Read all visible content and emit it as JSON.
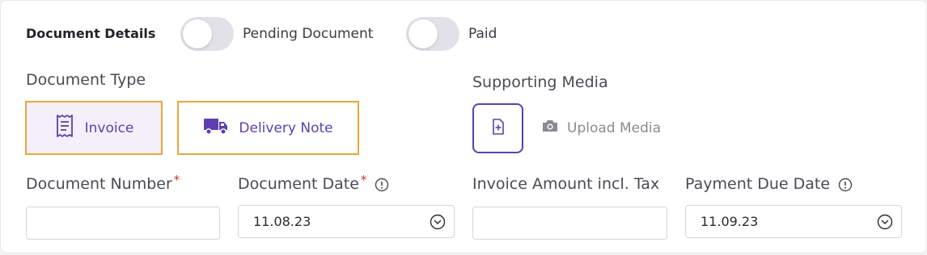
{
  "header": {
    "title": "Document Details",
    "toggles": [
      {
        "label": "Pending Document",
        "checked": false
      },
      {
        "label": "Paid",
        "checked": false
      }
    ]
  },
  "document_type": {
    "label": "Document Type",
    "options": [
      {
        "label": "Invoice",
        "icon": "receipt-icon",
        "selected": true
      },
      {
        "label": "Delivery Note",
        "icon": "truck-icon",
        "selected": false
      }
    ]
  },
  "supporting_media": {
    "label": "Supporting Media",
    "upload_label": "Upload Media",
    "icons": [
      "file-plus-icon",
      "camera-icon"
    ]
  },
  "fields": {
    "document_number": {
      "label": "Document Number",
      "required_mark": "*",
      "value": ""
    },
    "document_date": {
      "label": "Document Date",
      "required_mark": "*",
      "value": "11.08.23"
    },
    "invoice_amount": {
      "label": "Invoice Amount incl. Tax",
      "value": ""
    },
    "payment_due_date": {
      "label": "Payment Due Date",
      "value": "11.09.23"
    }
  },
  "colors": {
    "accent": "#5e3fb0",
    "highlight_border": "#f0a43a",
    "required": "#c0392b",
    "toggle_off": "#e2e1ea"
  }
}
